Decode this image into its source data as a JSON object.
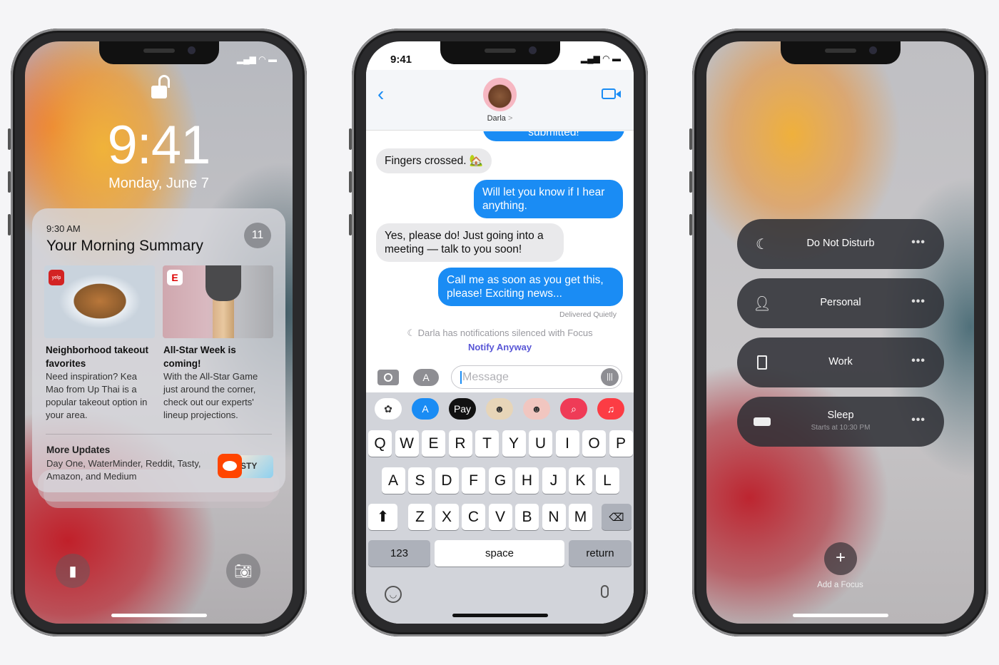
{
  "lock_screen": {
    "time": "9:41",
    "date": "Monday, June 7",
    "summary": {
      "time": "9:30 AM",
      "title": "Your Morning Summary",
      "count": "11",
      "stories": [
        {
          "title": "Neighborhood takeout favorites",
          "body": "Need inspiration? Kea Mao from Up Thai is a popular takeout option in your area.",
          "app_badge": "yelp"
        },
        {
          "title": "All-Star Week is coming!",
          "body": "With the All-Star Game just around the corner, check out our experts' lineup projections.",
          "app_badge": "E"
        }
      ],
      "more_title": "More Updates",
      "more_body": "Day One, WaterMinder, Reddit, Tasty, Amazon, and Medium",
      "more_icon_text": "STY"
    }
  },
  "messages": {
    "status_time": "9:41",
    "contact": "Darla",
    "contact_chevron": ">",
    "conversation": [
      {
        "side": "out",
        "text": "submitted!"
      },
      {
        "side": "in",
        "text": "Fingers crossed. 🏡"
      },
      {
        "side": "out",
        "text": "Will let you know if I hear anything."
      },
      {
        "side": "in",
        "text": "Yes, please do! Just going into a meeting — talk to you soon!"
      },
      {
        "side": "out",
        "text": "Call me as soon as you get this, please! Exciting news..."
      }
    ],
    "delivered": "Delivered Quietly",
    "focus_notice": "Darla has notifications silenced with Focus",
    "notify_anyway": "Notify Anyway",
    "input_placeholder": "Message",
    "app_strip": [
      "photos",
      "app-store",
      "Pay",
      "memoji",
      "animoji",
      "search",
      "music"
    ],
    "keyboard": {
      "row1": [
        "Q",
        "W",
        "E",
        "R",
        "T",
        "Y",
        "U",
        "I",
        "O",
        "P"
      ],
      "row2": [
        "A",
        "S",
        "D",
        "F",
        "G",
        "H",
        "J",
        "K",
        "L"
      ],
      "row3": [
        "Z",
        "X",
        "C",
        "V",
        "B",
        "N",
        "M"
      ],
      "numbers": "123",
      "space": "space",
      "return": "return"
    },
    "colors": {
      "bubble_out": "#1a8cf4",
      "bubble_in": "#e9e9eb",
      "notify_link": "#5856d6"
    }
  },
  "focus": {
    "modes": [
      {
        "label": "Do Not Disturb",
        "icon": "moon-icon"
      },
      {
        "label": "Personal",
        "icon": "person-icon"
      },
      {
        "label": "Work",
        "icon": "badge-icon"
      },
      {
        "label": "Sleep",
        "sub": "Starts at 10:30 PM",
        "icon": "bed-icon"
      }
    ],
    "add_label": "Add a Focus"
  }
}
